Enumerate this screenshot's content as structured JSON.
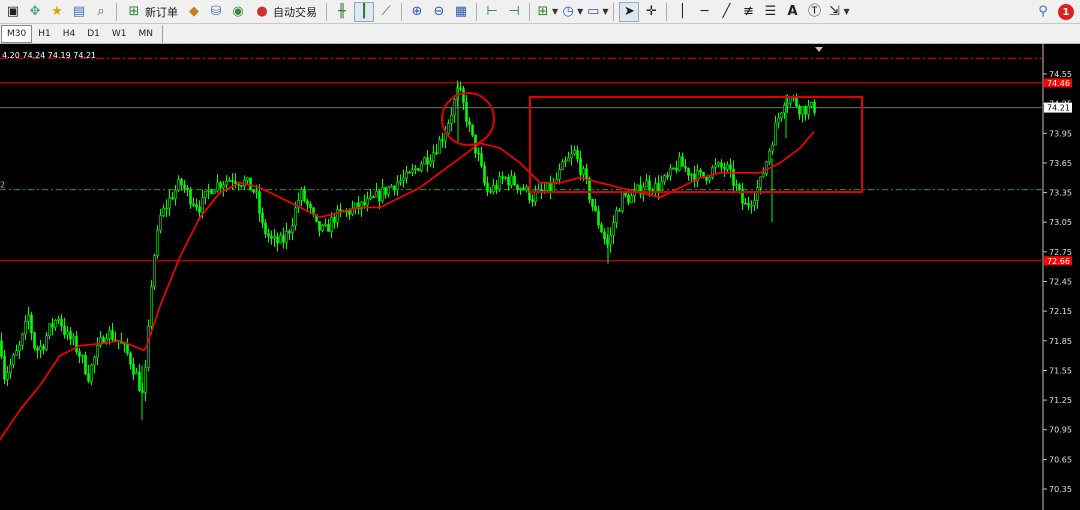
{
  "toolbar": {
    "new_order_label": "新订单",
    "auto_trade_label": "自动交易",
    "notification_count": "1",
    "icons": [
      "new-chart-icon",
      "profiles-icon",
      "favorites-icon",
      "market-watch-icon",
      "navigator-icon",
      "new-order-icon",
      "metaeditor-icon",
      "strategy-tester-icon",
      "terminal-icon",
      "auto-trading-icon",
      "bar-chart-icon",
      "candlestick-icon",
      "line-chart-icon",
      "zoom-in-icon",
      "zoom-out-icon",
      "tile-windows-icon",
      "chart-shift-icon",
      "autoscroll-icon",
      "indicators-icon",
      "periods-icon",
      "templates-icon",
      "cursor-icon",
      "crosshair-icon",
      "vertical-line-icon",
      "horizontal-line-icon",
      "trendline-icon",
      "equidistant-channel-icon",
      "fibonacci-icon",
      "text-icon",
      "text-label-icon",
      "arrows-icon",
      "search-icon"
    ]
  },
  "timeframes": [
    "M30",
    "H1",
    "H4",
    "D1",
    "W1",
    "MN"
  ],
  "active_timeframe": "M30",
  "chart": {
    "ohlc_text": "4.20 74.24 74.19 74.21",
    "left_level_label": "2",
    "current_price_label": "74.21",
    "high_level_label": "74.46",
    "low_level_label": "72.66",
    "axis_ticks": [
      "74.55",
      "74.25",
      "73.95",
      "73.65",
      "73.35",
      "73.05",
      "72.75",
      "72.45",
      "72.15",
      "71.85",
      "71.55",
      "71.25",
      "70.95",
      "70.65",
      "70.35"
    ],
    "colors": {
      "background": "#000000",
      "candle": "#00ff00",
      "ma": "#ff0000",
      "level": "#ff0000",
      "dash_level": "#1fa01f",
      "price_line": "#888888",
      "annotation": "#e00000"
    }
  },
  "chart_data": {
    "type": "candlestick",
    "title": "",
    "xlabel": "",
    "ylabel": "",
    "ylim": [
      70.3,
      74.8
    ],
    "timeframe": "M30",
    "last_price": 74.21,
    "levels": [
      {
        "kind": "resistance",
        "price": 74.46
      },
      {
        "kind": "support",
        "price": 72.66
      },
      {
        "kind": "dash-red",
        "price": 74.71
      },
      {
        "kind": "dash-green",
        "price": 73.38
      },
      {
        "kind": "bid",
        "price": 74.21
      }
    ],
    "price_anchors": [
      [
        0,
        71.85
      ],
      [
        4,
        71.5
      ],
      [
        10,
        71.6
      ],
      [
        20,
        71.8
      ],
      [
        28,
        72.1
      ],
      [
        35,
        71.75
      ],
      [
        42,
        71.8
      ],
      [
        48,
        71.95
      ],
      [
        58,
        72.1
      ],
      [
        66,
        71.9
      ],
      [
        72,
        71.85
      ],
      [
        80,
        71.7
      ],
      [
        88,
        71.5
      ],
      [
        95,
        71.7
      ],
      [
        105,
        71.95
      ],
      [
        118,
        71.85
      ],
      [
        128,
        71.7
      ],
      [
        136,
        71.5
      ],
      [
        142,
        71.3
      ],
      [
        146,
        71.6
      ],
      [
        152,
        72.6
      ],
      [
        160,
        73.1
      ],
      [
        170,
        73.3
      ],
      [
        180,
        73.45
      ],
      [
        190,
        73.3
      ],
      [
        200,
        73.2
      ],
      [
        210,
        73.4
      ],
      [
        220,
        73.45
      ],
      [
        232,
        73.5
      ],
      [
        245,
        73.45
      ],
      [
        255,
        73.35
      ],
      [
        262,
        73.0
      ],
      [
        272,
        72.85
      ],
      [
        282,
        72.85
      ],
      [
        290,
        73.0
      ],
      [
        300,
        73.35
      ],
      [
        308,
        73.2
      ],
      [
        316,
        73.0
      ],
      [
        324,
        72.95
      ],
      [
        334,
        73.1
      ],
      [
        345,
        73.15
      ],
      [
        358,
        73.2
      ],
      [
        370,
        73.25
      ],
      [
        382,
        73.35
      ],
      [
        395,
        73.45
      ],
      [
        408,
        73.5
      ],
      [
        420,
        73.65
      ],
      [
        432,
        73.75
      ],
      [
        444,
        73.95
      ],
      [
        452,
        74.2
      ],
      [
        458,
        74.4
      ],
      [
        464,
        74.2
      ],
      [
        470,
        73.95
      ],
      [
        478,
        73.7
      ],
      [
        486,
        73.35
      ],
      [
        494,
        73.4
      ],
      [
        504,
        73.5
      ],
      [
        514,
        73.45
      ],
      [
        522,
        73.4
      ],
      [
        532,
        73.3
      ],
      [
        542,
        73.35
      ],
      [
        552,
        73.4
      ],
      [
        562,
        73.6
      ],
      [
        574,
        73.75
      ],
      [
        584,
        73.5
      ],
      [
        594,
        73.15
      ],
      [
        602,
        72.95
      ],
      [
        608,
        72.8
      ],
      [
        614,
        73.1
      ],
      [
        622,
        73.3
      ],
      [
        632,
        73.3
      ],
      [
        644,
        73.45
      ],
      [
        656,
        73.4
      ],
      [
        668,
        73.5
      ],
      [
        678,
        73.65
      ],
      [
        690,
        73.55
      ],
      [
        702,
        73.5
      ],
      [
        714,
        73.6
      ],
      [
        726,
        73.6
      ],
      [
        736,
        73.4
      ],
      [
        744,
        73.2
      ],
      [
        752,
        73.3
      ],
      [
        760,
        73.45
      ],
      [
        768,
        73.75
      ],
      [
        776,
        74.05
      ],
      [
        784,
        74.3
      ],
      [
        792,
        74.3
      ],
      [
        800,
        74.2
      ],
      [
        810,
        74.2
      ],
      [
        816,
        74.21
      ]
    ],
    "ma_anchors": [
      [
        0,
        70.85
      ],
      [
        20,
        71.15
      ],
      [
        40,
        71.4
      ],
      [
        60,
        71.7
      ],
      [
        80,
        71.8
      ],
      [
        100,
        71.82
      ],
      [
        120,
        71.85
      ],
      [
        145,
        71.75
      ],
      [
        160,
        72.2
      ],
      [
        180,
        72.7
      ],
      [
        200,
        73.1
      ],
      [
        220,
        73.35
      ],
      [
        240,
        73.45
      ],
      [
        260,
        73.4
      ],
      [
        280,
        73.3
      ],
      [
        300,
        73.2
      ],
      [
        320,
        73.1
      ],
      [
        340,
        73.15
      ],
      [
        360,
        73.2
      ],
      [
        380,
        73.2
      ],
      [
        400,
        73.3
      ],
      [
        420,
        73.4
      ],
      [
        440,
        73.55
      ],
      [
        460,
        73.7
      ],
      [
        480,
        73.85
      ],
      [
        500,
        73.8
      ],
      [
        520,
        73.65
      ],
      [
        540,
        73.45
      ],
      [
        560,
        73.45
      ],
      [
        580,
        73.5
      ],
      [
        600,
        73.45
      ],
      [
        620,
        73.4
      ],
      [
        640,
        73.35
      ],
      [
        660,
        73.3
      ],
      [
        680,
        73.4
      ],
      [
        700,
        73.5
      ],
      [
        720,
        73.55
      ],
      [
        740,
        73.55
      ],
      [
        760,
        73.55
      ],
      [
        780,
        73.65
      ],
      [
        800,
        73.8
      ],
      [
        815,
        73.98
      ]
    ]
  }
}
